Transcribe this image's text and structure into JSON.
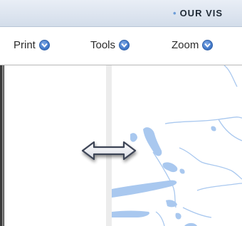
{
  "header": {
    "banner_text": "OUR VIS"
  },
  "toolbar": {
    "items": [
      {
        "label": "Print"
      },
      {
        "label": "Tools"
      },
      {
        "label": "Zoom"
      }
    ]
  },
  "colors": {
    "water": "#a9c8ef",
    "header_gradient": "#d3ddea",
    "dropdown_icon": "#3c74c6"
  },
  "icons": {
    "dropdown": "chevron-down-circle-icon",
    "resize_cursor": "horizontal-resize-cursor-icon"
  }
}
